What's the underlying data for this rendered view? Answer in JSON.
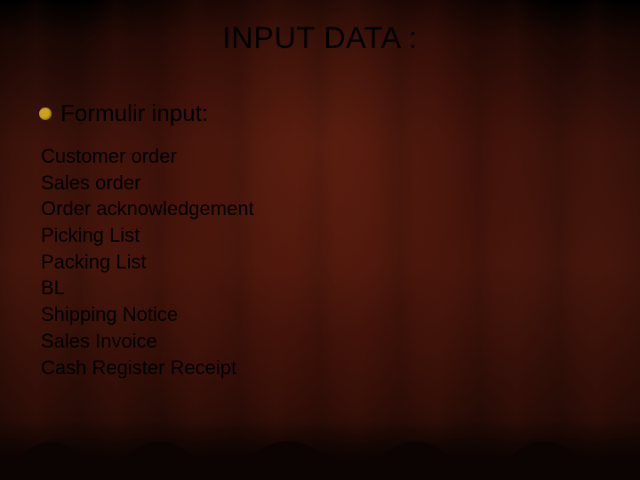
{
  "title": "INPUT DATA :",
  "bullet": {
    "label": "Formulir input:"
  },
  "list": {
    "items": [
      "Customer order",
      "Sales order",
      "Order acknowledgement",
      "Picking List",
      "Packing List",
      "BL",
      "Shipping Notice",
      "Sales Invoice",
      "Cash Register Receipt"
    ]
  }
}
